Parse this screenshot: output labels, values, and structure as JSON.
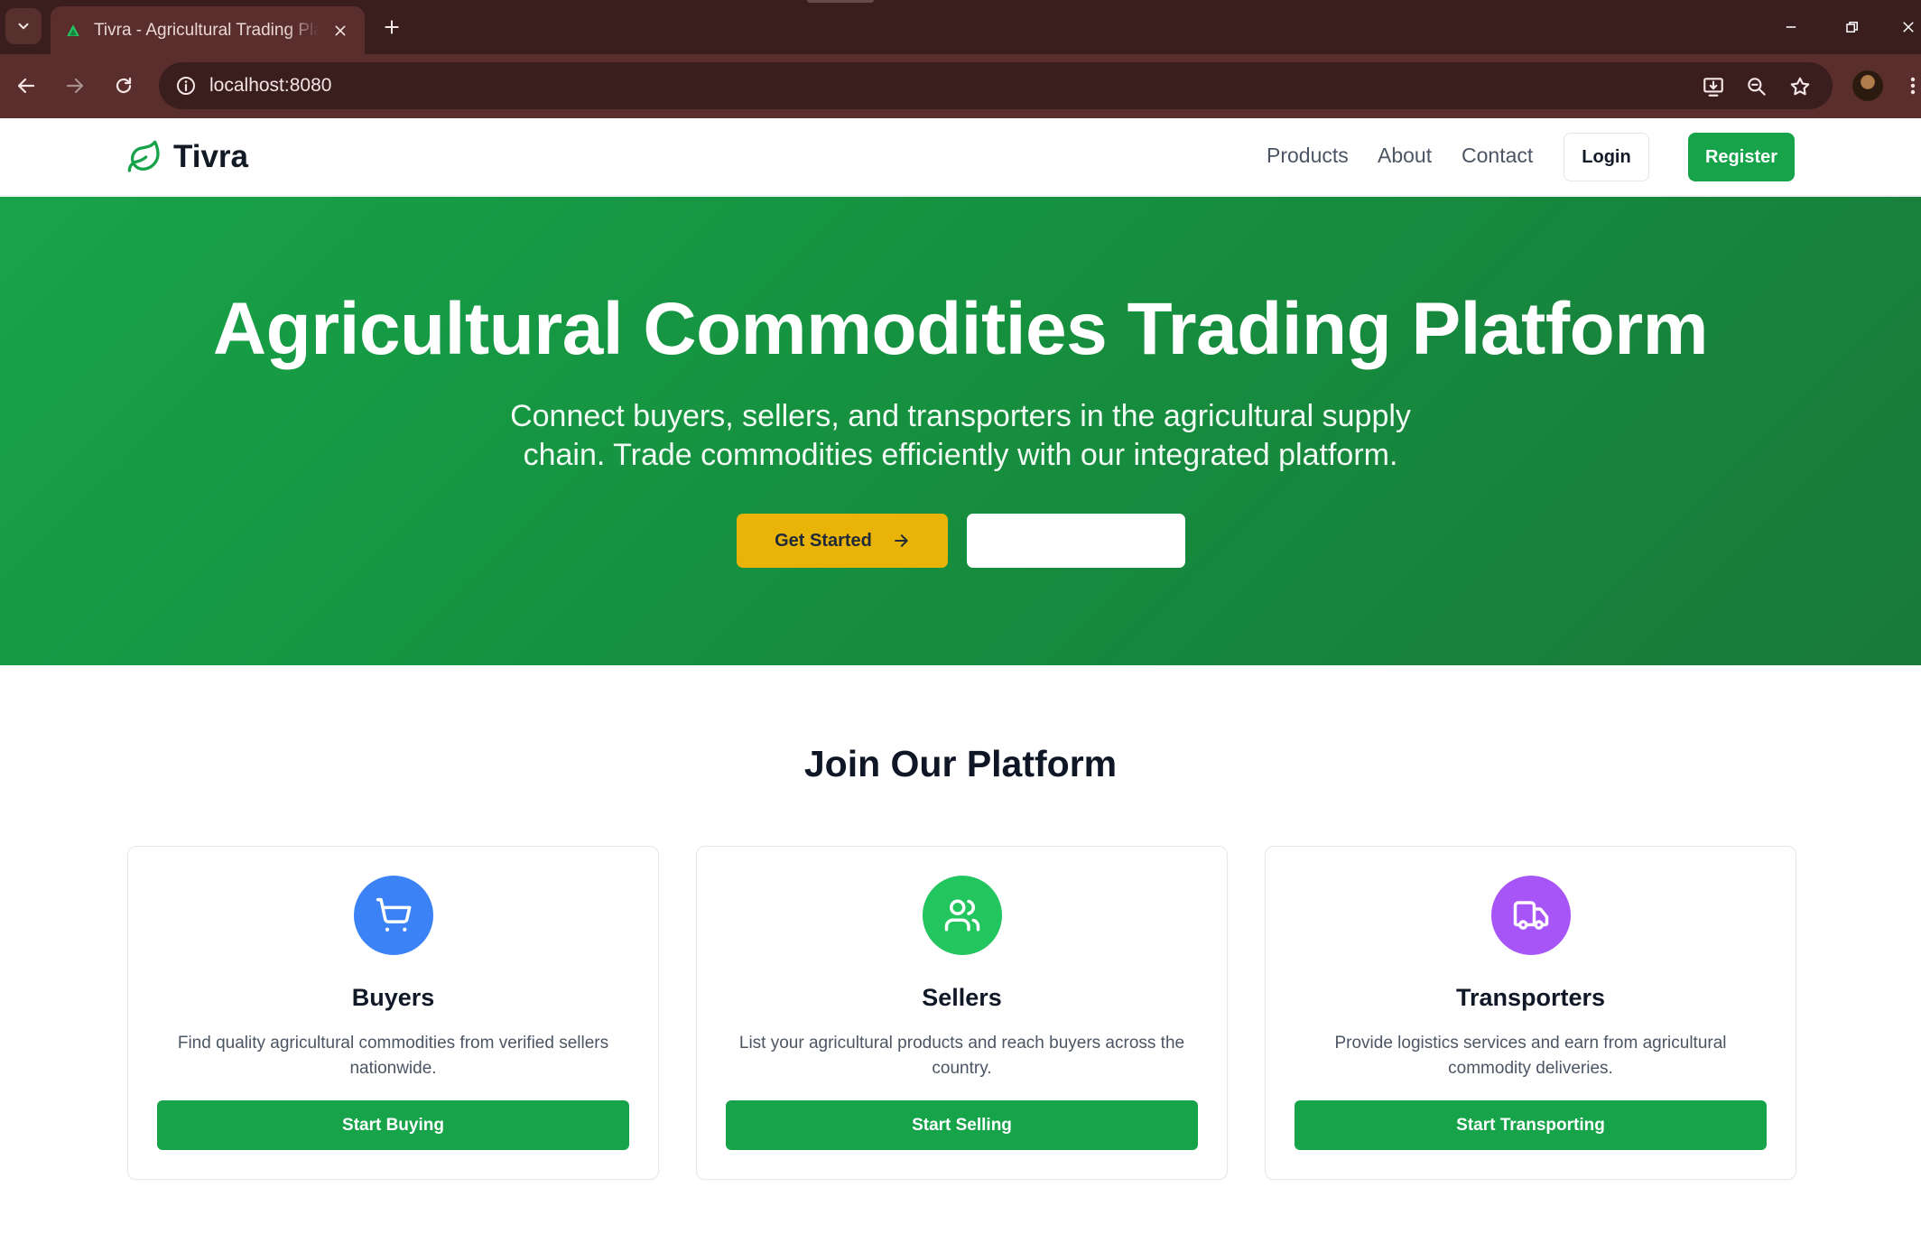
{
  "browser": {
    "tab_title": "Tivra - Agricultural Trading Platform",
    "url": "localhost:8080",
    "icons": {
      "tab_menu": "chevron-down-icon",
      "tab_close": "close-icon",
      "new_tab": "plus-icon",
      "minimize": "minimize-icon",
      "restore": "restore-icon",
      "close_window": "close-icon",
      "back": "back-arrow-icon",
      "forward": "forward-arrow-icon",
      "reload": "reload-icon",
      "site_info": "info-icon",
      "install": "install-app-icon",
      "zoom": "zoom-icon",
      "bookmark": "star-icon",
      "menu": "more-vert-icon"
    }
  },
  "site": {
    "brand": "Tivra",
    "nav": {
      "products": "Products",
      "about": "About",
      "contact": "Contact",
      "login": "Login",
      "register": "Register"
    },
    "hero": {
      "title": "Agricultural Commodities Trading Platform",
      "subtitle": "Connect buyers, sellers, and transporters in the agricultural supply chain. Trade commodities efficiently with our integrated platform.",
      "primary_cta": "Get Started",
      "secondary_cta": ""
    },
    "join": {
      "title": "Join Our Platform",
      "cards": [
        {
          "title": "Buyers",
          "description": "Find quality agricultural commodities from verified sellers nationwide.",
          "button": "Start Buying",
          "icon": "shopping-cart-icon",
          "color": "#3b82f6"
        },
        {
          "title": "Sellers",
          "description": "List your agricultural products and reach buyers across the country.",
          "button": "Start Selling",
          "icon": "users-icon",
          "color": "#22c55e"
        },
        {
          "title": "Transporters",
          "description": "Provide logistics services and earn from agricultural commodity deliveries.",
          "button": "Start Transporting",
          "icon": "truck-icon",
          "color": "#a855f7"
        }
      ]
    }
  },
  "colors": {
    "chrome_dark": "#3a1d1d",
    "chrome_tab": "#5a2e2d",
    "brand_green": "#16a34a",
    "cta_yellow": "#eab308"
  }
}
